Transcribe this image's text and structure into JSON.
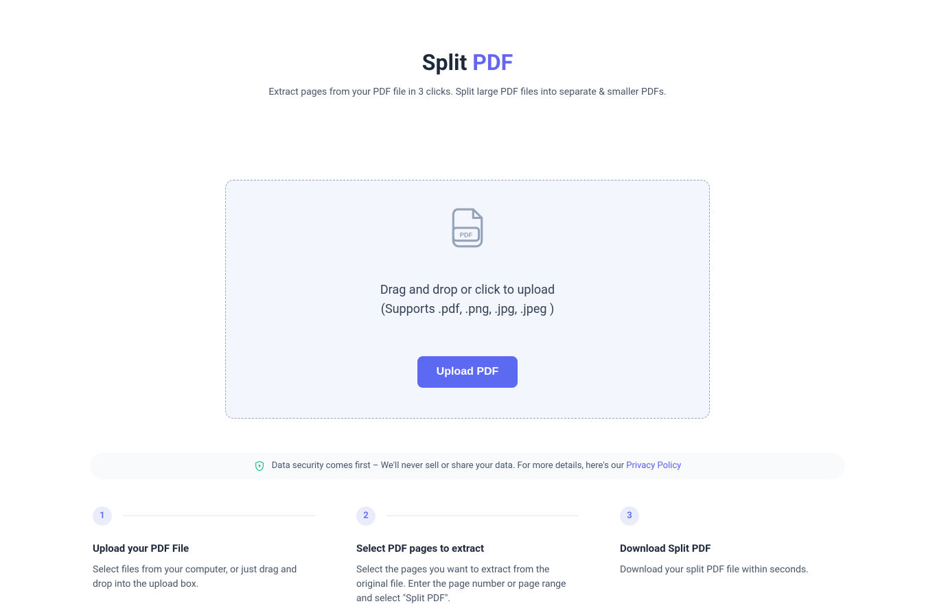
{
  "title": {
    "prefix": "Split ",
    "accent": "PDF"
  },
  "subtitle": "Extract pages from your PDF file in 3 clicks. Split large PDF files into separate & smaller PDFs.",
  "upload": {
    "dropzone_line1": "Drag and drop or click to upload",
    "dropzone_line2": "(Supports .pdf, .png, .jpg, .jpeg )",
    "button_label": "Upload PDF"
  },
  "security": {
    "text": "Data security comes first – We'll never sell or share your data. For more details, here's our ",
    "link_label": "Privacy Policy"
  },
  "steps": [
    {
      "number": "1",
      "title": "Upload your PDF File",
      "desc": "Select files from your computer, or just drag and drop into the upload box."
    },
    {
      "number": "2",
      "title": "Select PDF pages to extract",
      "desc": "Select the pages you want to extract from the original file. Enter the page number or page range and select \"Split PDF\"."
    },
    {
      "number": "3",
      "title": "Download Split PDF",
      "desc": "Download your split PDF file within seconds."
    }
  ]
}
